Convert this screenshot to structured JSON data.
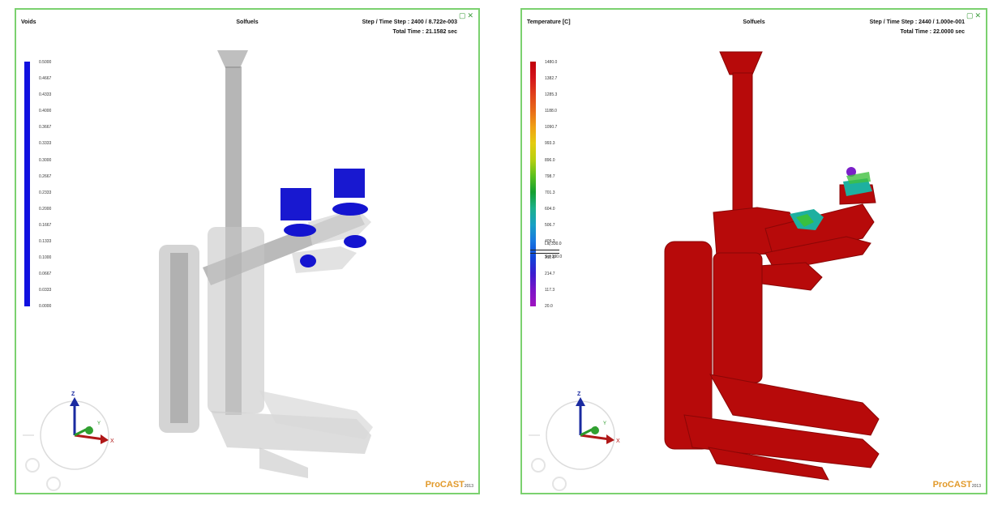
{
  "left": {
    "title": "Voids",
    "solver": "Solfuels",
    "step_line": "Step / Time Step : 2400 / 8.722e-003",
    "total_line": "Total Time : 21.1582 sec",
    "legend_color": "#1010e0",
    "legend_labels": [
      "0.5000",
      "0.4667",
      "0.4333",
      "0.4000",
      "0.3667",
      "0.3333",
      "0.3000",
      "0.2667",
      "0.2333",
      "0.2000",
      "0.1667",
      "0.1333",
      "0.1000",
      "0.0667",
      "0.0333",
      "0.0000"
    ],
    "axis_labels": {
      "z": "Z",
      "y": "Y",
      "x": "X"
    },
    "brand": "ProCAST",
    "brand_suffix": "2013"
  },
  "right": {
    "title": "Temperature [C]",
    "solver": "Solfuels",
    "step_line": "Step / Time Step : 2440 / 1.000e-001",
    "total_line": "Total Time : 22.0000 sec",
    "legend_labels": [
      "1480.0",
      "1382.7",
      "1285.3",
      "1188.0",
      "1090.7",
      "993.3",
      "896.0",
      "798.7",
      "701.3",
      "604.0",
      "506.7",
      "409.3",
      "312.0",
      "214.7",
      "117.3",
      "20.0"
    ],
    "legend_colors": [
      "#c0000a",
      "#d4141a",
      "#e0401a",
      "#e86a18",
      "#f0a014",
      "#e4cc10",
      "#b8d010",
      "#5cc01c",
      "#14a030",
      "#1cb08c",
      "#18a0c4",
      "#1878e0",
      "#1044d8",
      "#3c1cd0",
      "#7a14c8",
      "#a014c0"
    ],
    "probe_liq": "Liq 330.0",
    "probe_sol": "Sol 330.0",
    "axis_labels": {
      "z": "Z",
      "y": "Y",
      "x": "X"
    },
    "brand": "ProCAST",
    "brand_suffix": "2013"
  },
  "window_buttons": "▢✕"
}
